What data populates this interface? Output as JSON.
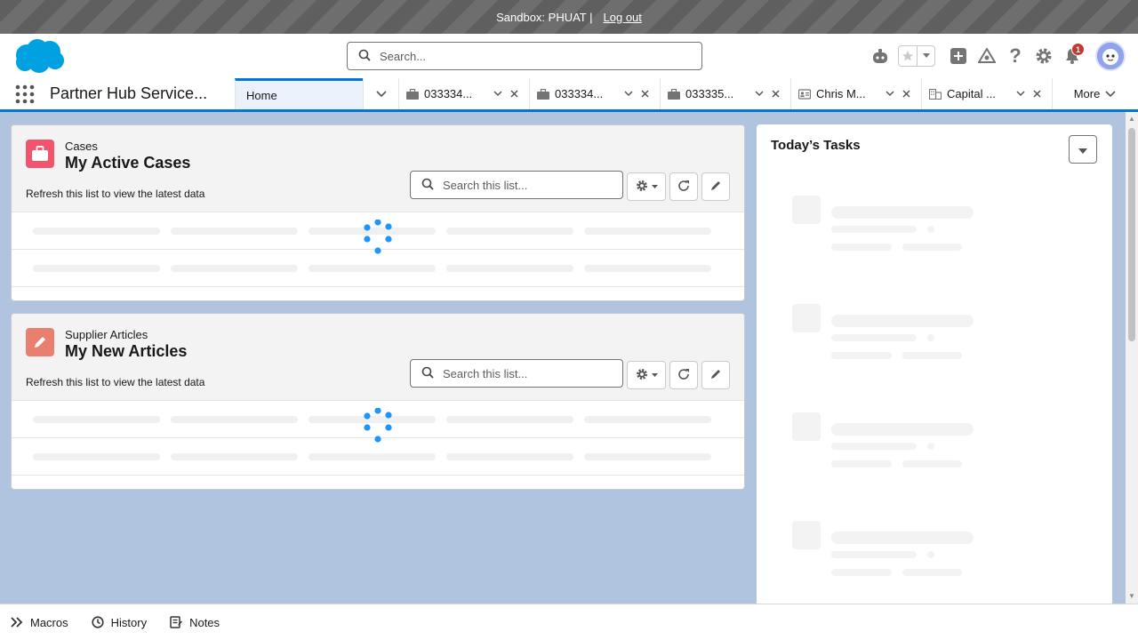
{
  "sandbox": {
    "text": "Sandbox: PHUAT |",
    "logout": "Log out"
  },
  "header": {
    "search_placeholder": "Search...",
    "notification_count": "1"
  },
  "nav": {
    "app_name": "Partner Hub Service...",
    "home_tab": "Home",
    "tabs": [
      {
        "label": "033334...",
        "icon": "case-icon"
      },
      {
        "label": "033334...",
        "icon": "case-icon"
      },
      {
        "label": "033335...",
        "icon": "case-icon"
      },
      {
        "label": "Chris M...",
        "icon": "contact-icon"
      },
      {
        "label": "Capital ...",
        "icon": "account-icon"
      }
    ],
    "more": "More"
  },
  "cases_card": {
    "object_type": "Cases",
    "title": "My Active Cases",
    "refresh_note": "Refresh this list to view the latest data",
    "search_placeholder": "Search this list...",
    "icon_color": "#f2536d"
  },
  "articles_card": {
    "object_type": "Supplier Articles",
    "title": "My New Articles",
    "refresh_note": "Refresh this list to view the latest data",
    "search_placeholder": "Search this list...",
    "icon_color": "#e9806f"
  },
  "tasks": {
    "title": "Today’s Tasks"
  },
  "utility": {
    "macros": "Macros",
    "history": "History",
    "notes": "Notes"
  },
  "colors": {
    "brand": "#0176d3",
    "background": "#b0c4df",
    "spinner": "#1b96ff"
  }
}
